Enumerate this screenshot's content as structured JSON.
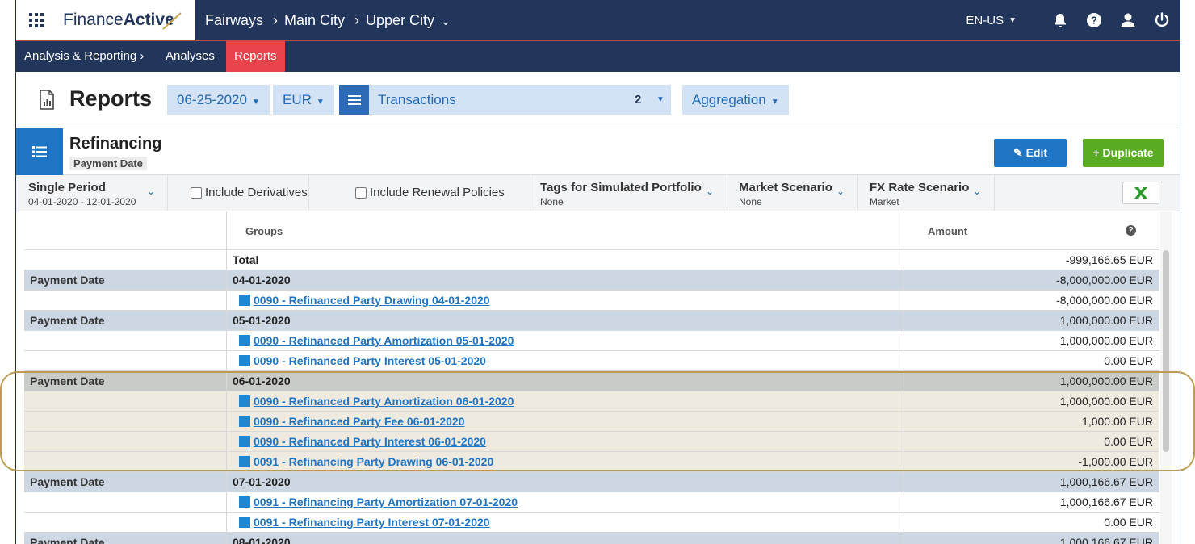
{
  "topbar": {
    "logo_regular": "Finance",
    "logo_bold": "Active",
    "breadcrumb": [
      "Fairways",
      "Main City",
      "Upper City"
    ],
    "language": "EN-US"
  },
  "subnav": {
    "items": [
      "Analysis & Reporting ›",
      "Analyses",
      "Reports"
    ],
    "active": "Reports"
  },
  "header": {
    "title": "Reports",
    "date": "06-25-2020",
    "currency": "EUR",
    "transactions_label": "Transactions",
    "transactions_count": "2",
    "aggregation": "Aggregation"
  },
  "report": {
    "title": "Refinancing",
    "subtitle": "Payment Date",
    "edit_label": "Edit",
    "duplicate_label": "Duplicate"
  },
  "filters": {
    "period_title": "Single Period",
    "period_value": "04-01-2020 - 12-01-2020",
    "include_derivatives": "Include Derivatives",
    "include_renewal": "Include Renewal Policies",
    "tags_title": "Tags for Simulated Portfolio",
    "tags_value": "None",
    "market_title": "Market Scenario",
    "market_value": "None",
    "fx_title": "FX Rate Scenario",
    "fx_value": "Market"
  },
  "table": {
    "headers": {
      "groups": "Groups",
      "amount": "Amount"
    },
    "rows": [
      {
        "type": "plain",
        "c1": "",
        "c2": "Total",
        "link": false,
        "amount": "-999,166.65 EUR"
      },
      {
        "type": "group",
        "c1": "Payment Date",
        "c2": "04-01-2020",
        "link": false,
        "amount": "-8,000,000.00 EUR"
      },
      {
        "type": "plain",
        "c1": "",
        "c2": "0090 - Refinanced Party Drawing 04-01-2020",
        "link": true,
        "amount": "-8,000,000.00 EUR"
      },
      {
        "type": "group",
        "c1": "Payment Date",
        "c2": "05-01-2020",
        "link": false,
        "amount": "1,000,000.00 EUR"
      },
      {
        "type": "plain",
        "c1": "",
        "c2": "0090 - Refinanced Party Amortization 05-01-2020",
        "link": true,
        "amount": "1,000,000.00 EUR"
      },
      {
        "type": "plain",
        "c1": "",
        "c2": "0090 - Refinanced Party Interest 05-01-2020",
        "link": true,
        "amount": "0.00 EUR"
      },
      {
        "type": "hlg",
        "c1": "Payment Date",
        "c2": "06-01-2020",
        "link": false,
        "amount": "1,000,000.00 EUR"
      },
      {
        "type": "hl",
        "c1": "",
        "c2": "0090 - Refinanced Party Amortization 06-01-2020",
        "link": true,
        "amount": "1,000,000.00 EUR"
      },
      {
        "type": "hl",
        "c1": "",
        "c2": "0090 - Refinanced Party Fee 06-01-2020",
        "link": true,
        "amount": "1,000.00 EUR"
      },
      {
        "type": "hl",
        "c1": "",
        "c2": "0090 - Refinanced Party Interest 06-01-2020",
        "link": true,
        "amount": "0.00 EUR"
      },
      {
        "type": "hl",
        "c1": "",
        "c2": "0091 - Refinancing Party Drawing 06-01-2020",
        "link": true,
        "amount": "-1,000.00 EUR"
      },
      {
        "type": "group",
        "c1": "Payment Date",
        "c2": "07-01-2020",
        "link": false,
        "amount": "1,000,166.67 EUR"
      },
      {
        "type": "plain",
        "c1": "",
        "c2": "0091 - Refinancing Party Amortization 07-01-2020",
        "link": true,
        "amount": "1,000,166.67 EUR"
      },
      {
        "type": "plain",
        "c1": "",
        "c2": "0091 - Refinancing Party Interest 07-01-2020",
        "link": true,
        "amount": "0.00 EUR"
      },
      {
        "type": "group",
        "c1": "Payment Date",
        "c2": "08-01-2020",
        "link": false,
        "amount": "1,000,166.67 EUR"
      }
    ]
  }
}
